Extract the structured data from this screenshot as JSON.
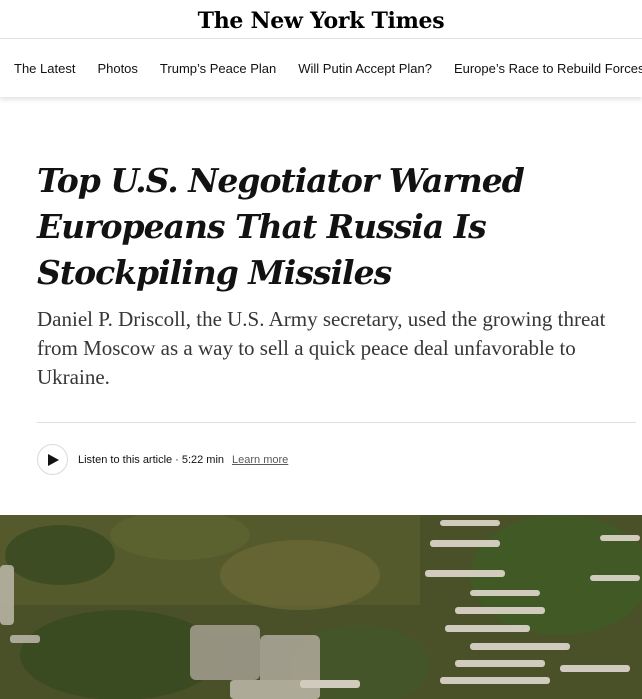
{
  "masthead": {
    "logo_text": "The New York Times"
  },
  "nav": {
    "items": [
      {
        "label": "The Latest"
      },
      {
        "label": "Photos"
      },
      {
        "label": "Trump’s Peace Plan"
      },
      {
        "label": "Will Putin Accept Plan?"
      },
      {
        "label": "Europe’s Race to Rebuild Forces"
      }
    ]
  },
  "article": {
    "headline": "Top U.S. Negotiator Warned Europeans That Russia Is Stockpiling Missiles",
    "summary": "Daniel P. Driscoll, the U.S. Army secretary, used the growing threat from Moscow as a way to sell a quick peace deal unfavorable to Ukraine.",
    "audio": {
      "label": "Listen to this article",
      "separator": "·",
      "duration": "5:22 min",
      "learn_more": "Learn more"
    }
  },
  "icons": {
    "play": "play-icon"
  },
  "colors": {
    "text": "#121212",
    "summary": "#363636",
    "grass": "#4f5a2e"
  }
}
